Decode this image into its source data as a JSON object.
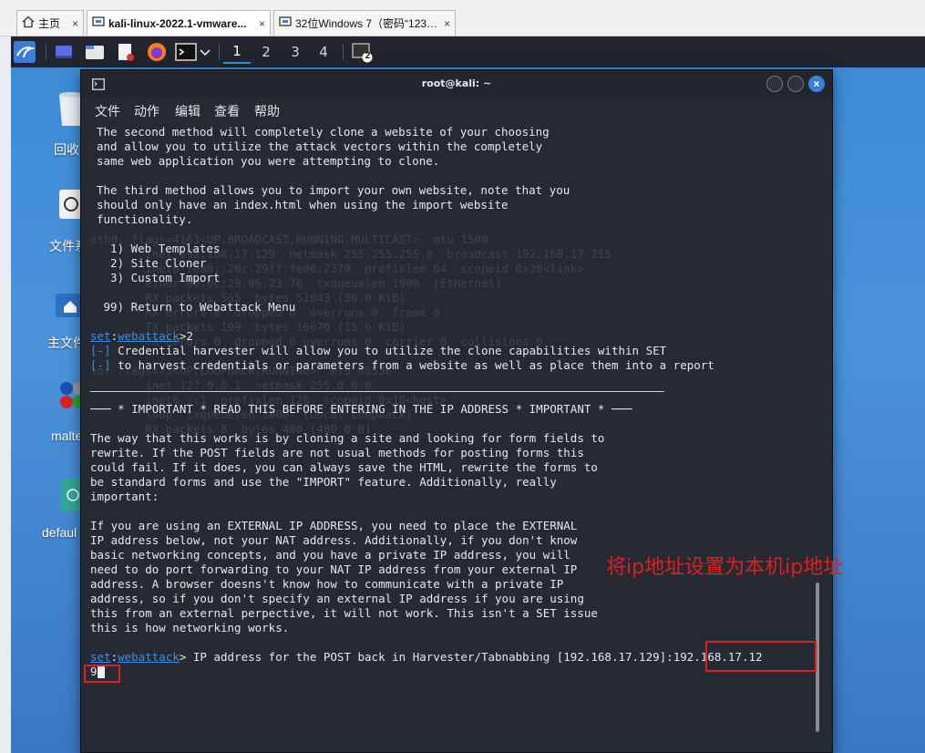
{
  "browser_tabs": [
    {
      "label": "主页",
      "icon": "home-icon",
      "active": false
    },
    {
      "label": "kali-linux-2022.1-vmware...",
      "icon": "vm-icon",
      "active": true
    },
    {
      "label": "32位Windows 7（密码“1234...",
      "icon": "vm-icon",
      "active": false
    }
  ],
  "tab_close_glyph": "×",
  "panel": {
    "workspaces": [
      "1",
      "2",
      "3",
      "4"
    ],
    "badge": "2"
  },
  "desktop_icons": [
    {
      "label": "回收",
      "icon": "trash-icon"
    },
    {
      "label": "文件系",
      "icon": "filesystem-icon"
    },
    {
      "label": "主文件",
      "icon": "home-folder-icon"
    },
    {
      "label": "malte",
      "icon": "maltego-icon"
    },
    {
      "label": "defaul",
      "icon": "default-file-icon"
    }
  ],
  "terminal": {
    "title": "root@kali: ~",
    "close_glyph": "×",
    "menu": [
      "文件",
      "动作",
      "编辑",
      "查看",
      "帮助"
    ],
    "lines": {
      "l1": "The second method will completely clone a website of your choosing",
      "l2": "and allow you to utilize the attack vectors within the completely",
      "l3": "same web application you were attempting to clone.",
      "l4": "The third method allows you to import your own website, note that you",
      "l5": "should only have an index.html when using the import website",
      "l6": "functionality.",
      "m1": "  1) Web Templates",
      "m2": "  2) Site Cloner",
      "m3": "  3) Custom Import",
      "m99": " 99) Return to Webattack Menu",
      "prompt1_set": "set",
      "prompt1_colon": ":",
      "prompt1_mod": "webattack",
      "prompt1_rest": ">2",
      "info_tag": "[-]",
      "info1": " Credential harvester will allow you to utilize the clone capabilities within SET",
      "info2": " to harvest credentials or parameters from a website as well as place them into a report",
      "important": "─── * IMPORTANT * READ THIS BEFORE ENTERING IN THE IP ADDRESS * IMPORTANT * ───",
      "p1": "The way that this works is by cloning a site and looking for form fields to",
      "p2": "rewrite. If the POST fields are not usual methods for posting forms this",
      "p3": "could fail. If it does, you can always save the HTML, rewrite the forms to",
      "p4": "be standard forms and use the \"IMPORT\" feature. Additionally, really",
      "p5": "important:",
      "q1": "If you are using an EXTERNAL IP ADDRESS, you need to place the EXTERNAL",
      "q2": "IP address below, not your NAT address. Additionally, if you don't know",
      "q3": "basic networking concepts, and you have a private IP address, you will",
      "q4": "need to do port forwarding to your NAT IP address from your external IP",
      "q5": "address. A browser doesns't know how to communicate with a private IP",
      "q6": "address, so if you don't specify an external IP address if you are using",
      "q7": "this from an external perpective, it will not work. This isn't a SET issue",
      "q8": "this is how networking works.",
      "prompt2_rest": "> IP address for the POST back in Harvester/Tabnabbing [192.168.17.129]:",
      "input1": "192.168.17.12",
      "input2": "9"
    },
    "background_text": "eth0: flags=4163<UP,BROADCAST,RUNNING,MULTICAST>  mtu 1500\n        inet 192.168.17.129  netmask 255.255.255.0  broadcast 192.168.17.255\n        inet6 fe80::20c:29ff:fe06:2370  prefixlen 64  scopeid 0x20<link>\n        ether 00:0c:29:06:23:70  txqueuelen 1000  (Ethernet)\n        RX packets 565  bytes 51043 (50.0 KiB)\n        RX errors 0  dropped 0  overruns 0  frame 0\n        TX packets 199  bytes 16070 (15.6 KiB)\n        TX errors 0  dropped 0 overruns 0  carrier 0  collisions 0\n\nlo: flags=73<UP,LOOPBACK,RUNNING>  mtu 65536\n        inet 127.0.0.1  netmask 255.0.0.0\n        inet6 ::1  prefixlen 128  scopeid 0x10<host>\n        loop  txqueuelen 1000  (Local Loopback)\n        RX packets 8  bytes 480 (480.0 B)"
  },
  "annotation": "将ip地址设置为本机ip地址",
  "colors": {
    "annotation_red": "#e02020",
    "prompt_blue": "#3f8ee6",
    "terminal_bg": "#262a33"
  }
}
